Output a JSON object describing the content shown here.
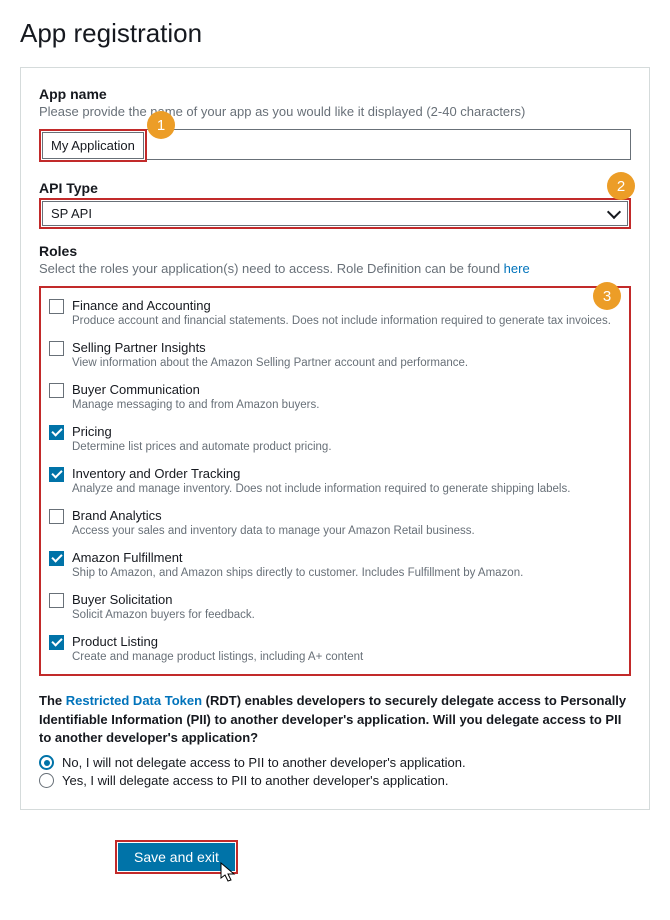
{
  "page": {
    "title": "App registration"
  },
  "appname": {
    "label": "App name",
    "hint": "Please provide the name of your app as you would like it displayed (2-40 characters)",
    "value": "My Application"
  },
  "apitype": {
    "label": "API Type",
    "selected": "SP API"
  },
  "roles": {
    "label": "Roles",
    "hint_prefix": "Select the roles your application(s) need to access. Role Definition can be found ",
    "hint_link": "here",
    "items": [
      {
        "name": "Finance and Accounting",
        "desc": "Produce account and financial statements. Does not include information required to generate tax invoices.",
        "checked": false
      },
      {
        "name": "Selling Partner Insights",
        "desc": "View information about the Amazon Selling Partner account and performance.",
        "checked": false
      },
      {
        "name": "Buyer Communication",
        "desc": "Manage messaging to and from Amazon buyers.",
        "checked": false
      },
      {
        "name": "Pricing",
        "desc": "Determine list prices and automate product pricing.",
        "checked": true
      },
      {
        "name": "Inventory and Order Tracking",
        "desc": "Analyze and manage inventory. Does not include information required to generate shipping labels.",
        "checked": true
      },
      {
        "name": "Brand Analytics",
        "desc": "Access your sales and inventory data to manage your Amazon Retail business.",
        "checked": false
      },
      {
        "name": "Amazon Fulfillment",
        "desc": "Ship to Amazon, and Amazon ships directly to customer. Includes Fulfillment by Amazon.",
        "checked": true
      },
      {
        "name": "Buyer Solicitation",
        "desc": "Solicit Amazon buyers for feedback.",
        "checked": false
      },
      {
        "name": "Product Listing",
        "desc": "Create and manage product listings, including A+ content",
        "checked": true
      }
    ]
  },
  "rdt": {
    "prefix": "The ",
    "link": "Restricted Data Token",
    "suffix": " (RDT) enables developers to securely delegate access to Personally Identifiable Information (PII) to another developer's application. Will you delegate access to PII to another developer's application?",
    "options": [
      {
        "label": "No, I will not delegate access to PII to another developer's application.",
        "selected": true
      },
      {
        "label": "Yes, I will delegate access to PII to another developer's application.",
        "selected": false
      }
    ]
  },
  "footer": {
    "save_label": "Save and exit"
  },
  "annotations": {
    "b1": "1",
    "b2": "2",
    "b3": "3"
  }
}
